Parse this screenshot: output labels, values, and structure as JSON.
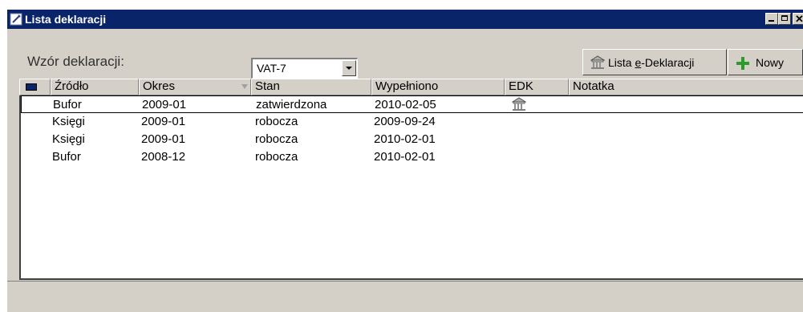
{
  "window": {
    "title": "Lista deklaracji",
    "icon": "form-icon"
  },
  "titlebar_buttons": [
    "minimize-icon",
    "maximize-icon",
    "close-icon"
  ],
  "form": {
    "label": "Wzór deklaracji:",
    "select_value": "VAT-7"
  },
  "toolbar": {
    "lista_prefix": "Lista ",
    "lista_accel": "e",
    "lista_suffix": "-Deklaracji",
    "lista_icon": "building-icon",
    "nowy_label": "Nowy",
    "nowy_icon": "plus-icon"
  },
  "columns": [
    {
      "label": ""
    },
    {
      "label": "Źródło"
    },
    {
      "label": "Okres"
    },
    {
      "label": "Stan"
    },
    {
      "label": "Wypełniono"
    },
    {
      "label": "EDK"
    },
    {
      "label": "Notatka"
    }
  ],
  "sort_column": "Okres",
  "rows": [
    {
      "zrodlo": "Bufor",
      "okres": "2009-01",
      "stan": "zatwierdzona",
      "wypelniono": "2010-02-05",
      "edk": "building-icon",
      "notatka": ""
    },
    {
      "zrodlo": "Księgi",
      "okres": "2009-01",
      "stan": "robocza",
      "wypelniono": "2009-09-24",
      "edk": "",
      "notatka": ""
    },
    {
      "zrodlo": "Księgi",
      "okres": "2009-01",
      "stan": "robocza",
      "wypelniono": "2010-02-01",
      "edk": "",
      "notatka": ""
    },
    {
      "zrodlo": "Bufor",
      "okres": "2008-12",
      "stan": "robocza",
      "wypelniono": "2010-02-01",
      "edk": "",
      "notatka": ""
    }
  ],
  "colors": {
    "titlebar": "#0a246a",
    "face": "#d4d0c8",
    "accent_green": "#2e9a2e"
  }
}
